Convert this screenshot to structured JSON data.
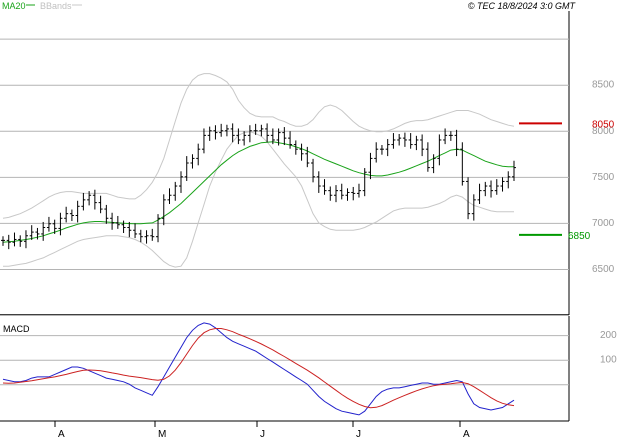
{
  "header": {
    "legend_ma": "MA20",
    "legend_bb": "BBands",
    "copyright": "© TEC 18/8/2024 3:0 GMT"
  },
  "colors": {
    "price": "#000000",
    "ma": "#1aa31a",
    "bands": "#c8c8c8",
    "resistance": "#cc0000",
    "support": "#009900",
    "macd": "#2222cc",
    "signal": "#cc2222",
    "grid": "#b4b4b4",
    "axis_text": "#999999"
  },
  "chart_data": [
    {
      "type": "ohlc",
      "title": "",
      "x_months": [
        "A",
        "M",
        "J",
        "J",
        "A"
      ],
      "y_ticks": [
        "8500",
        "8000",
        "7500",
        "7000",
        "6500"
      ],
      "ylim": [
        6000,
        9300
      ],
      "levels": [
        {
          "label": "8050",
          "value": 8080,
          "role": "resistance"
        },
        {
          "label": "6850",
          "value": 6870,
          "role": "support"
        }
      ],
      "closes": [
        6810,
        6790,
        6820,
        6800,
        6860,
        6900,
        6880,
        6950,
        6990,
        6940,
        7050,
        7100,
        7080,
        7180,
        7250,
        7300,
        7220,
        7150,
        7050,
        7000,
        6980,
        6950,
        6920,
        6880,
        6850,
        6860,
        6850,
        7050,
        7250,
        7300,
        7400,
        7500,
        7650,
        7700,
        7800,
        7950,
        8000,
        7980,
        8000,
        8020,
        7950,
        7900,
        7950,
        8000,
        8000,
        8020,
        7950,
        7900,
        7980,
        7920,
        7850,
        7800,
        7750,
        7650,
        7500,
        7400,
        7350,
        7300,
        7350,
        7300,
        7330,
        7320,
        7350,
        7550,
        7700,
        7800,
        7800,
        7850,
        7900,
        7920,
        7900,
        7850,
        7900,
        7800,
        7600,
        7700,
        7900,
        7950,
        7950,
        7800,
        7450,
        7100,
        7250,
        7350,
        7400,
        7350,
        7400,
        7450,
        7500,
        7600
      ],
      "ma20": [
        6790,
        6795,
        6800,
        6810,
        6820,
        6830,
        6845,
        6860,
        6880,
        6900,
        6920,
        6945,
        6965,
        6985,
        7000,
        7010,
        7015,
        7015,
        7010,
        7005,
        7000,
        6995,
        6992,
        6990,
        6990,
        6995,
        7000,
        7030,
        7070,
        7110,
        7160,
        7210,
        7270,
        7330,
        7390,
        7450,
        7510,
        7570,
        7630,
        7680,
        7730,
        7770,
        7800,
        7830,
        7850,
        7870,
        7875,
        7880,
        7870,
        7860,
        7845,
        7825,
        7805,
        7780,
        7750,
        7720,
        7690,
        7665,
        7640,
        7615,
        7590,
        7565,
        7545,
        7530,
        7515,
        7510,
        7510,
        7520,
        7535,
        7550,
        7570,
        7595,
        7620,
        7645,
        7670,
        7700,
        7730,
        7760,
        7790,
        7800,
        7790,
        7760,
        7730,
        7700,
        7670,
        7650,
        7630,
        7615,
        7610,
        7610
      ],
      "bb_upper": [
        7050,
        7060,
        7080,
        7100,
        7130,
        7160,
        7200,
        7240,
        7280,
        7310,
        7330,
        7340,
        7340,
        7330,
        7320,
        7320,
        7320,
        7320,
        7320,
        7300,
        7280,
        7270,
        7260,
        7260,
        7300,
        7360,
        7440,
        7550,
        7700,
        7900,
        8100,
        8300,
        8450,
        8550,
        8600,
        8620,
        8620,
        8600,
        8570,
        8530,
        8450,
        8330,
        8250,
        8190,
        8160,
        8150,
        8150,
        8150,
        8120,
        8100,
        8070,
        8050,
        8050,
        8070,
        8120,
        8200,
        8260,
        8280,
        8260,
        8220,
        8160,
        8100,
        8050,
        8020,
        8000,
        7990,
        7990,
        8000,
        8020,
        8050,
        8080,
        8100,
        8110,
        8110,
        8120,
        8140,
        8160,
        8180,
        8200,
        8220,
        8220,
        8220,
        8200,
        8180,
        8150,
        8120,
        8100,
        8080,
        8060,
        8050
      ],
      "bb_lower": [
        6530,
        6530,
        6540,
        6550,
        6560,
        6580,
        6600,
        6620,
        6650,
        6680,
        6710,
        6740,
        6770,
        6800,
        6820,
        6830,
        6840,
        6850,
        6860,
        6860,
        6860,
        6850,
        6840,
        6820,
        6790,
        6750,
        6700,
        6640,
        6580,
        6540,
        6520,
        6530,
        6620,
        6800,
        7000,
        7200,
        7400,
        7550,
        7680,
        7800,
        7880,
        7950,
        7980,
        7990,
        7970,
        7940,
        7880,
        7800,
        7720,
        7640,
        7570,
        7500,
        7400,
        7250,
        7100,
        7000,
        6960,
        6930,
        6920,
        6920,
        6920,
        6920,
        6930,
        6950,
        6980,
        7010,
        7050,
        7090,
        7130,
        7150,
        7160,
        7160,
        7160,
        7160,
        7170,
        7190,
        7210,
        7240,
        7280,
        7300,
        7280,
        7230,
        7190,
        7170,
        7150,
        7130,
        7120,
        7120,
        7120,
        7120
      ]
    },
    {
      "type": "line",
      "title": "MACD",
      "y_ticks": [
        "200",
        "100"
      ],
      "ylim": [
        -150,
        270
      ],
      "series": [
        {
          "role": "macd",
          "values": [
            20,
            15,
            10,
            10,
            15,
            25,
            30,
            30,
            30,
            40,
            50,
            60,
            70,
            70,
            65,
            55,
            45,
            35,
            25,
            20,
            15,
            10,
            0,
            -15,
            -25,
            -35,
            -45,
            -10,
            30,
            70,
            110,
            150,
            190,
            220,
            240,
            250,
            245,
            230,
            210,
            190,
            175,
            165,
            155,
            145,
            135,
            120,
            105,
            90,
            75,
            60,
            45,
            30,
            15,
            0,
            -25,
            -50,
            -70,
            -85,
            -100,
            -110,
            -115,
            -120,
            -125,
            -110,
            -80,
            -50,
            -30,
            -20,
            -15,
            -15,
            -10,
            -5,
            0,
            5,
            5,
            0,
            0,
            5,
            10,
            15,
            10,
            -40,
            -80,
            -95,
            -100,
            -105,
            -100,
            -95,
            -80,
            -65
          ]
        },
        {
          "role": "signal",
          "values": [
            5,
            4,
            5,
            8,
            11,
            14,
            18,
            22,
            26,
            30,
            35,
            40,
            46,
            52,
            57,
            58,
            57,
            55,
            51,
            46,
            42,
            37,
            33,
            30,
            27,
            23,
            19,
            16,
            20,
            34,
            57,
            88,
            123,
            158,
            188,
            210,
            222,
            227,
            227,
            222,
            214,
            204,
            195,
            185,
            175,
            164,
            152,
            140,
            126,
            113,
            99,
            85,
            71,
            57,
            42,
            26,
            9,
            -8,
            -25,
            -42,
            -57,
            -70,
            -82,
            -91,
            -96,
            -94,
            -87,
            -76,
            -65,
            -55,
            -45,
            -36,
            -27,
            -19,
            -12,
            -6,
            -2,
            0,
            2,
            5,
            7,
            2,
            -10,
            -25,
            -40,
            -55,
            -68,
            -78,
            -84,
            -87
          ]
        }
      ]
    }
  ]
}
